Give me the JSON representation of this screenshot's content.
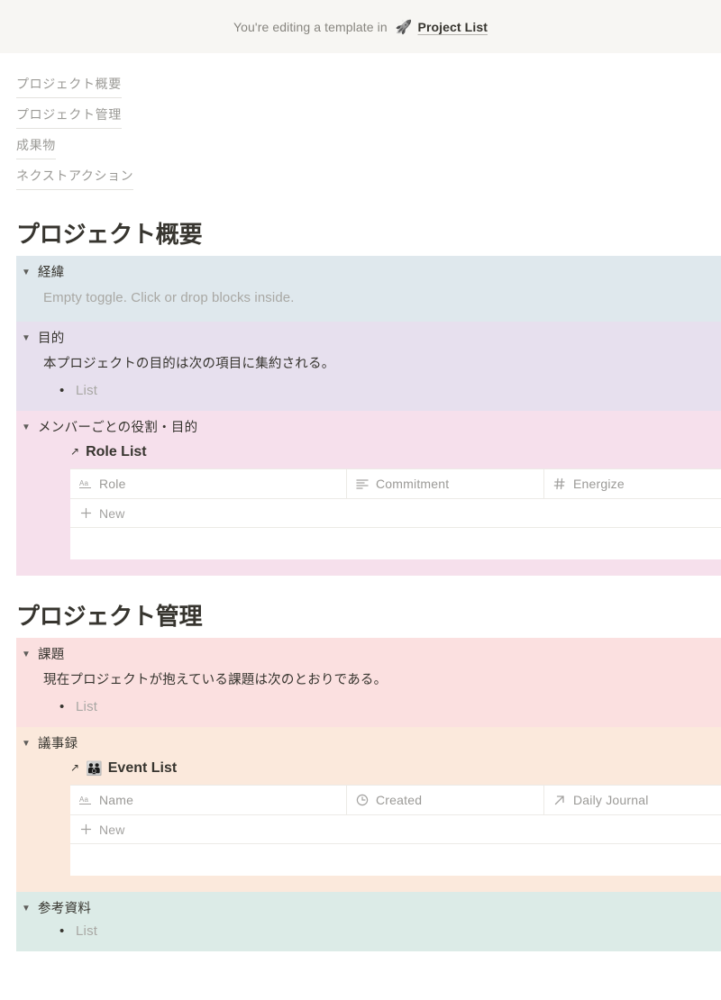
{
  "banner": {
    "text": "You're editing a template in",
    "rocket_icon": "rocket-icon",
    "link_label": "Project List"
  },
  "toc": {
    "items": [
      {
        "label": "プロジェクト概要"
      },
      {
        "label": "プロジェクト管理"
      },
      {
        "label": "成果物"
      },
      {
        "label": "ネクストアクション"
      }
    ]
  },
  "sections": [
    {
      "heading": "プロジェクト概要",
      "toggles": [
        {
          "title": "経緯",
          "color": "#dfe8ed",
          "placeholder": "Empty toggle. Click or drop blocks inside."
        },
        {
          "title": "目的",
          "color": "#e7e0ee",
          "paragraph": "本プロジェクトの目的は次の項目に集約される。",
          "bullet": "List"
        },
        {
          "title": "メンバーごとの役割・目的",
          "color": "#f6e0ec",
          "database": {
            "arrow_icon": "arrow-up-right-icon",
            "emoji": "",
            "title": "Role List",
            "columns": [
              {
                "icon": "title-text-icon",
                "label": "Role"
              },
              {
                "icon": "rich-text-icon",
                "label": "Commitment"
              },
              {
                "icon": "number-hash-icon",
                "label": "Energize"
              }
            ],
            "new_row_label": "New"
          }
        }
      ]
    },
    {
      "heading": "プロジェクト管理",
      "toggles": [
        {
          "title": "課題",
          "color": "#fbe0e0",
          "paragraph": "現在プロジェクトが抱えている課題は次のとおりである。",
          "bullet": "List"
        },
        {
          "title": "議事録",
          "color": "#fbe9dc",
          "database": {
            "arrow_icon": "arrow-up-right-icon",
            "emoji": "👪",
            "title": "Event List",
            "columns": [
              {
                "icon": "title-text-icon",
                "label": "Name"
              },
              {
                "icon": "clock-icon",
                "label": "Created"
              },
              {
                "icon": "arrow-up-right-icon",
                "label": "Daily Journal"
              }
            ],
            "new_row_label": "New"
          }
        },
        {
          "title": "参考資料",
          "color": "#dcebe7",
          "bullet": "List"
        }
      ]
    }
  ],
  "icons": {
    "triangle_down": "▼",
    "bullet_dot": "•",
    "arrow_up_right": "↗",
    "plus": "+"
  },
  "colors": {
    "banner_bg": "#f7f6f3",
    "text_primary": "#37352f",
    "text_muted": "#9b9a96"
  }
}
